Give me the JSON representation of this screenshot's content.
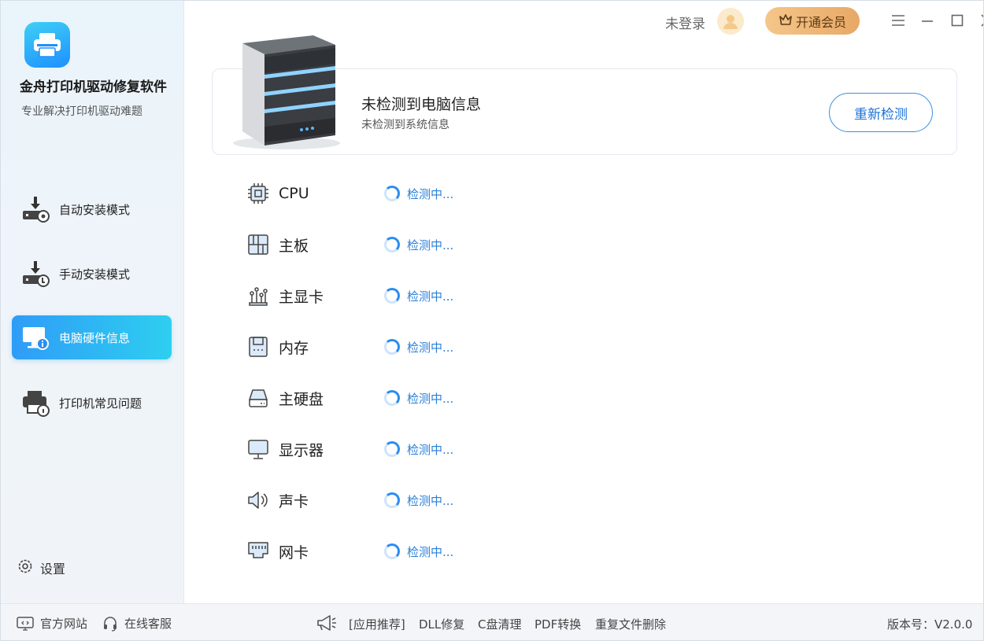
{
  "app": {
    "title": "金舟打印机驱动修复软件",
    "subtitle": "专业解决打印机驱动难题"
  },
  "nav": {
    "items": [
      {
        "label": "自动安装模式",
        "icon": "download-drive-gear-icon"
      },
      {
        "label": "手动安装模式",
        "icon": "download-drive-hand-icon"
      },
      {
        "label": "电脑硬件信息",
        "icon": "monitor-info-icon",
        "active": true
      },
      {
        "label": "打印机常见问题",
        "icon": "printer-question-icon"
      }
    ],
    "settings_label": "设置"
  },
  "topbar": {
    "login_text": "未登录",
    "vip_label": "开通会员"
  },
  "info": {
    "title": "未检测到电脑信息",
    "subtitle": "未检测到系统信息",
    "recheck_label": "重新检测"
  },
  "hardware": [
    {
      "label": "CPU",
      "icon": "cpu-icon",
      "status": "检测中..."
    },
    {
      "label": "主板",
      "icon": "motherboard-icon",
      "status": "检测中..."
    },
    {
      "label": "主显卡",
      "icon": "graphics-card-icon",
      "status": "检测中..."
    },
    {
      "label": "内存",
      "icon": "memory-icon",
      "status": "检测中..."
    },
    {
      "label": "主硬盘",
      "icon": "hard-disk-icon",
      "status": "检测中..."
    },
    {
      "label": "显示器",
      "icon": "display-icon",
      "status": "检测中..."
    },
    {
      "label": "声卡",
      "icon": "speaker-icon",
      "status": "检测中..."
    },
    {
      "label": "网卡",
      "icon": "network-card-icon",
      "status": "检测中..."
    }
  ],
  "footer": {
    "website": "官方网站",
    "support": "在线客服",
    "recommend_tag": "[应用推荐]",
    "links": [
      "DLL修复",
      "C盘清理",
      "PDF转换",
      "重复文件删除"
    ],
    "version": "版本号：V2.0.0"
  },
  "colors": {
    "accent": "#2a8df0",
    "active_nav_start": "#2f9cf7",
    "active_nav_end": "#2ecff0",
    "vip": "#e8a866"
  }
}
